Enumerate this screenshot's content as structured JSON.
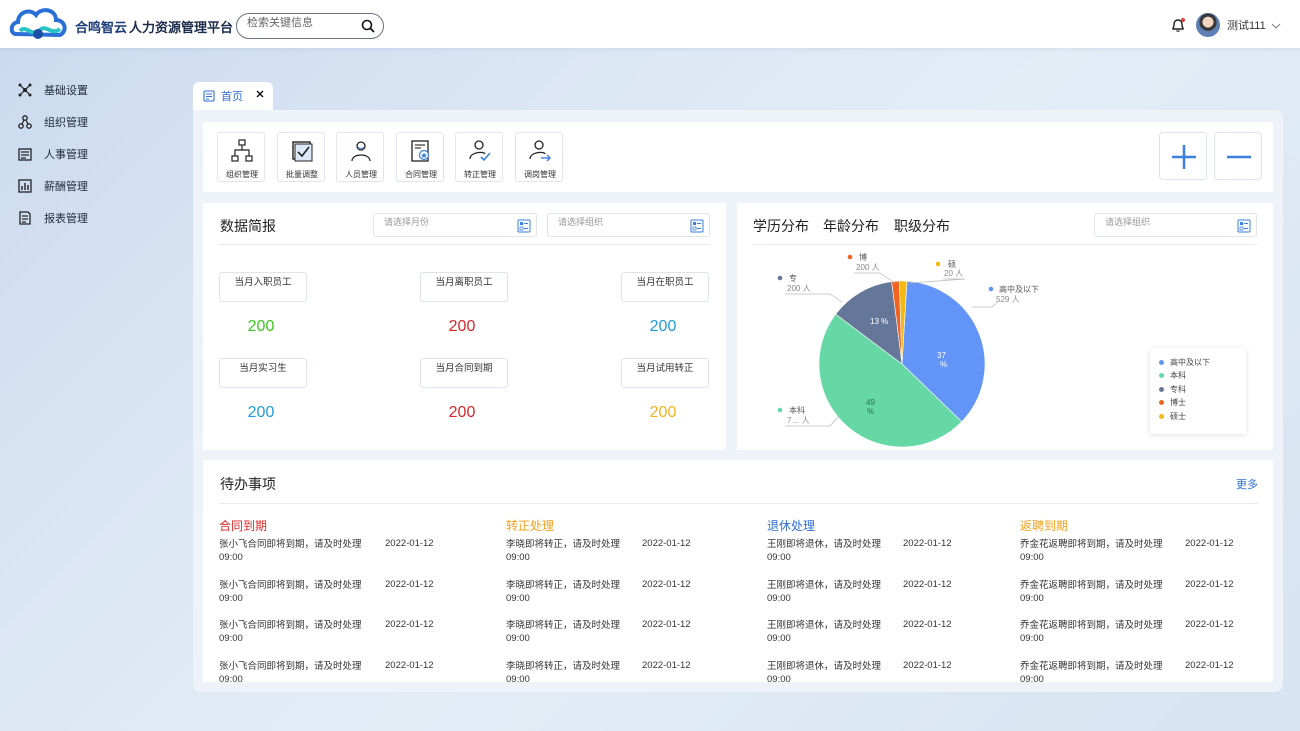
{
  "header": {
    "brand": "合鸣智云",
    "product": "人力资源管理平台",
    "search_placeholder": "检索关键信息",
    "username": "测试111"
  },
  "sidebar": {
    "items": [
      {
        "label": "基础设置",
        "icon": "network-icon"
      },
      {
        "label": "组织管理",
        "icon": "org-icon"
      },
      {
        "label": "人事管理",
        "icon": "personnel-icon"
      },
      {
        "label": "薪酬管理",
        "icon": "salary-icon"
      },
      {
        "label": "报表管理",
        "icon": "report-icon"
      }
    ]
  },
  "tab": {
    "label": "首页"
  },
  "shortcuts": [
    {
      "label": "组织管理",
      "icon": "org-chart-icon"
    },
    {
      "label": "批量调整",
      "icon": "checkbox-icon"
    },
    {
      "label": "人员管理",
      "icon": "person-icon"
    },
    {
      "label": "合同管理",
      "icon": "contract-icon"
    },
    {
      "label": "转正管理",
      "icon": "person-check-icon"
    },
    {
      "label": "调岗管理",
      "icon": "person-transfer-icon"
    }
  ],
  "report": {
    "title": "数据简报",
    "month_placeholder": "请选择月份",
    "org_placeholder": "请选择组织",
    "stats": [
      {
        "label": "当月入职员工",
        "value": "200",
        "color": "#3ec91e"
      },
      {
        "label": "当月离职员工",
        "value": "200",
        "color": "#d5272a"
      },
      {
        "label": "当月在职员工",
        "value": "200",
        "color": "#1e9bd8"
      },
      {
        "label": "当月实习生",
        "value": "200",
        "color": "#1e9bd8"
      },
      {
        "label": "当月合同到期",
        "value": "200",
        "color": "#d5272a"
      },
      {
        "label": "当月试用转正",
        "value": "200",
        "color": "#f3b21c"
      }
    ]
  },
  "distribution": {
    "tabs": [
      "学历分布",
      "年龄分布",
      "职级分布"
    ],
    "org_placeholder": "请选择组织",
    "slice_labels": {
      "high": {
        "name": "高中及以下",
        "count": "529 人",
        "pct": "37 %"
      },
      "bachelor": {
        "name": "本科",
        "count": "7… 人",
        "pct": "49 %"
      },
      "college": {
        "name": "专",
        "count": "200 人",
        "pct": "13 %"
      },
      "doctor": {
        "name": "博",
        "count": "200 人"
      },
      "master": {
        "name": "硕",
        "count": "20 人"
      }
    }
  },
  "chart_data": {
    "type": "pie",
    "categories": [
      "高中及以下",
      "本科",
      "专科",
      "博士",
      "硕士"
    ],
    "values": [
      37,
      49,
      13,
      1.5,
      1.5
    ],
    "colors": [
      "#6395f8",
      "#65d8a6",
      "#657798",
      "#f26322",
      "#f5b915"
    ],
    "legend": "right",
    "title": ""
  },
  "todo": {
    "title": "待办事项",
    "more": "更多",
    "columns": [
      {
        "title": "合同到期",
        "color": "#e0272a",
        "text": "张小飞合同即将到期，请及时处理",
        "date": "2022-01-12",
        "time": "09:00"
      },
      {
        "title": "转正处理",
        "color": "#f3a11c",
        "text": "李晓即将转正，请及时处理",
        "date": "2022-01-12",
        "time": "09:00"
      },
      {
        "title": "退休处理",
        "color": "#2f6fd6",
        "text": "王刚即将退休，请及时处理",
        "date": "2022-01-12",
        "time": "09:00"
      },
      {
        "title": "返聘到期",
        "color": "#f3a11c",
        "text": "乔金花返聘即将到期，请及时处理",
        "date": "2022-01-12",
        "time": "09:00"
      }
    ]
  }
}
